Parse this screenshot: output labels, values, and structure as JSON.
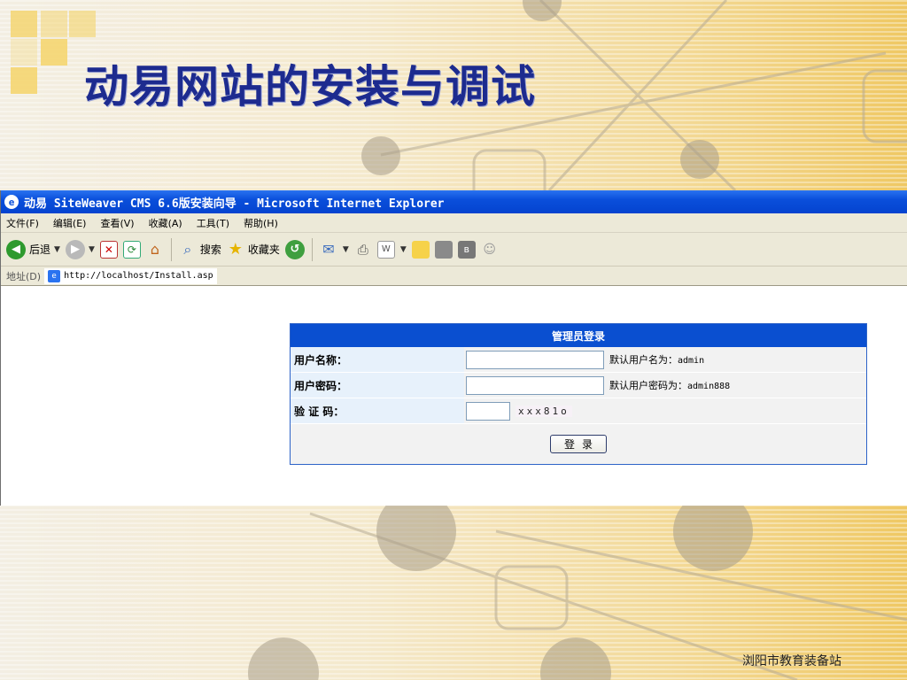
{
  "slide": {
    "title": "动易网站的安装与调试",
    "credit": "浏阳市教育装备站"
  },
  "colors": {
    "title": "#1d2b8f",
    "logo": "#f4d36a",
    "titlebar": "#0a4fdb",
    "panel_header": "#0a4fd0"
  },
  "window": {
    "title": "动易 SiteWeaver CMS 6.6版安装向导 - Microsoft Internet Explorer"
  },
  "menu": [
    "文件(F)",
    "编辑(E)",
    "查看(V)",
    "收藏(A)",
    "工具(T)",
    "帮助(H)"
  ],
  "toolbar": {
    "back_label": "后退",
    "search_label": "搜索",
    "favorites_label": "收藏夹"
  },
  "address": {
    "label": "地址(D)",
    "url": "http://localhost/Install.asp"
  },
  "login": {
    "header": "管理员登录",
    "username_label": "用户名称：",
    "username_value": "",
    "username_hint_prefix": "默认用户名为：",
    "username_hint_value": "admin",
    "password_label": "用户密码：",
    "password_value": "",
    "password_hint_prefix": "默认用户密码为：",
    "password_hint_value": "admin888",
    "captcha_label": "验 证 码：",
    "captcha_value": "",
    "captcha_image_text": "xxx81o",
    "submit_label": "登录"
  }
}
